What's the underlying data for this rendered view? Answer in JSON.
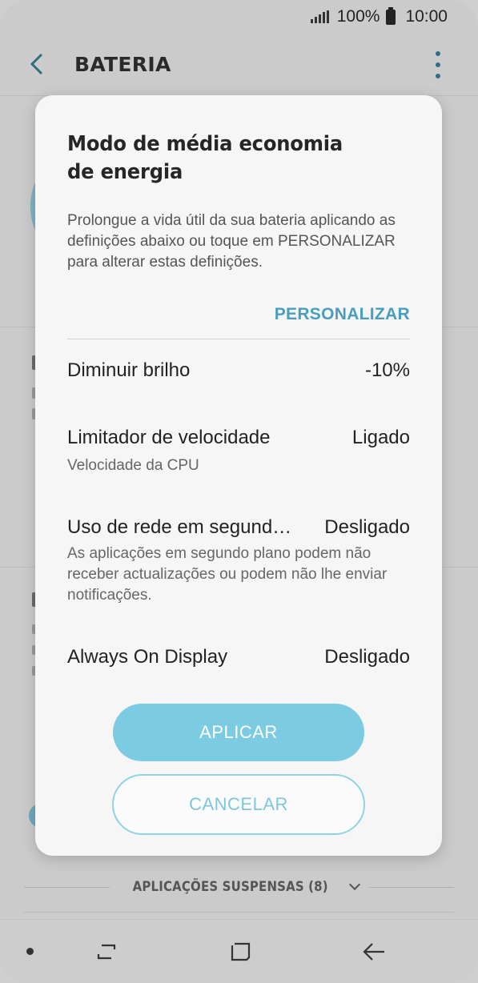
{
  "status_bar": {
    "battery_percent": "100%",
    "time": "10:00"
  },
  "app_bar": {
    "title": "BATERIA"
  },
  "background": {
    "suspended_apps_label": "APLICAÇÕES SUSPENSAS (8)"
  },
  "dialog": {
    "title": "Modo de média economia de energia",
    "description": "Prolongue a vida útil da sua bateria aplicando as definições abaixo ou toque em PERSONALIZAR para alterar estas definições.",
    "customize_label": "PERSONALIZAR",
    "settings": [
      {
        "name": "Diminuir brilho",
        "value": "-10%",
        "subtitle": ""
      },
      {
        "name": "Limitador de velocidade",
        "value": "Ligado",
        "subtitle": "Velocidade da CPU"
      },
      {
        "name": "Uso de rede em segund…",
        "value": "Desligado",
        "subtitle": "As aplicações em segundo plano podem não receber actualizações ou podem não lhe enviar notificações."
      },
      {
        "name": "Always On Display",
        "value": "Desligado",
        "subtitle": ""
      }
    ],
    "apply_label": "APLICAR",
    "cancel_label": "CANCELAR"
  },
  "colors": {
    "accent": "#4a9ebd",
    "apply_button": "#7bcbe3",
    "cancel_border": "#8fd3e6",
    "overlay_background": "#cbcbcb"
  },
  "icons": {
    "back": "arrow-left-icon",
    "more": "more-vertical-icon",
    "nav_recent": "recent-apps-icon",
    "nav_home": "home-icon",
    "nav_back": "back-arrow-icon"
  }
}
